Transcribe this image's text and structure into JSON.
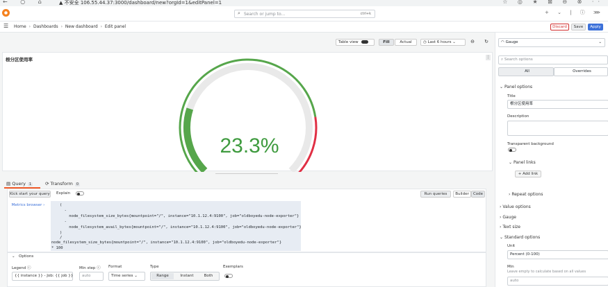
{
  "browser": {
    "nav_icons": "← ○ ⌂",
    "address": "▲ 不安全   106.55.44.37:3000/dashboard/new?orgId=1&editPanel=1",
    "right_icons": "☆ ◎ ★ ⊠ ⊖ ⊗ ··"
  },
  "topbar": {
    "search_placeholder": "Search or jump to...",
    "search_shortcut": "ctrl+k",
    "right_icons": "+ ⌄ | ⓘ ⋙"
  },
  "breadcrumb": {
    "home": "Home",
    "dashboards": "Dashboards",
    "new_dashboard": "New dashboard",
    "edit_panel": "Edit panel",
    "separator": "›"
  },
  "actions": {
    "discard": "Discard",
    "save": "Save",
    "apply": "Apply"
  },
  "toolbar": {
    "table_view": "Table view",
    "fill": "Fill",
    "actual": "Actual",
    "time_range": "Last 6 hours",
    "zoom_icon": "⊖",
    "refresh_icon": "↻"
  },
  "panel": {
    "title": "根分区使用率",
    "menu_icon": "⋮",
    "value": "23.3%",
    "gauge_fraction": 0.233,
    "threshold_fraction": 0.8,
    "colors": {
      "ok": "#56a64b",
      "threshold": "#e02f44",
      "track": "#e9e9e9",
      "value": "#3f9b3f"
    }
  },
  "query": {
    "tab_query": "Query",
    "tab_query_count": "1",
    "tab_transform": "Transform",
    "tab_transform_count": "0",
    "kick_start": "Kick start your query",
    "explain": "Explain",
    "run_queries": "Run queries",
    "builder": "Builder",
    "code": "Code",
    "metrics_browser": "Metrics browser ›",
    "lines": [
      "(",
      "  -",
      "    node_filesystem_size_bytes{mountpoint=\"/\", instance=\"10.1.12.4:9100\", job=\"oldboyedu-node-exporter\"}",
      "  -",
      "    node_filesystem_avail_bytes{mountpoint=\"/\", instance=\"10.1.12.4:9100\", job=\"oldboyedu-node-exporter\"}",
      ")",
      "/",
      "node_filesystem_size_bytes{mountpoint=\"/\", instance=\"10.1.12.4:9100\", job=\"oldboyedu-node-exporter\"}",
      "* 100"
    ]
  },
  "options": {
    "header": "Options",
    "legend_label": "Legend",
    "legend_value": "{{ instance }} - Job: {{ job }}",
    "min_step_label": "Min step",
    "min_step_placeholder": "auto",
    "format_label": "Format",
    "format_value": "Time series",
    "type_label": "Type",
    "type_range": "Range",
    "type_instant": "Instant",
    "type_both": "Both",
    "exemplars_label": "Exemplars"
  },
  "sidebar": {
    "viz_name": "Gauge",
    "search_placeholder": "Search options",
    "tab_all": "All",
    "tab_overrides": "Overrides",
    "panel_options": "Panel options",
    "title_label": "Title",
    "title_value": "根分区使用率",
    "description_label": "Description",
    "transparent_label": "Transparent background",
    "panel_links": "Panel links",
    "add_link": "+ Add link",
    "repeat_options": "Repeat options",
    "value_options": "Value options",
    "gauge": "Gauge",
    "text_size": "Text size",
    "standard_options": "Standard options",
    "unit_label": "Unit",
    "unit_value": "Percent (0-100)",
    "min_label": "Min",
    "min_help": "Leave empty to calculate based on all values",
    "min_placeholder": "auto"
  }
}
